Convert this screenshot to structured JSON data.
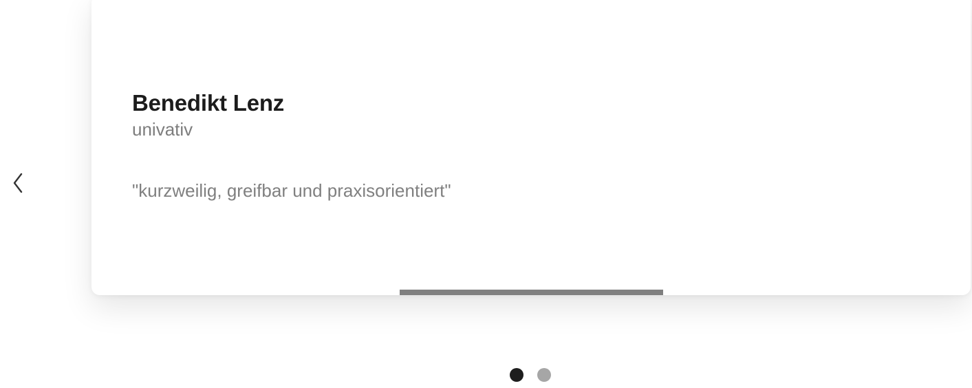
{
  "carousel": {
    "prev_icon": "chevron-left-icon",
    "testimonial": {
      "name": "Benedikt Lenz",
      "company": "univativ",
      "quote": "\"kurzweilig, greifbar und praxisorientiert\""
    },
    "progress_fraction": 0.3,
    "dots": {
      "count": 2,
      "active_index": 0
    },
    "colors": {
      "name": "#1c1c1c",
      "secondary_text": "#7d7d7d",
      "progress": "#7f7f7f",
      "dot_active": "#1e1e1e",
      "dot_inactive": "#a6a6a6"
    }
  }
}
